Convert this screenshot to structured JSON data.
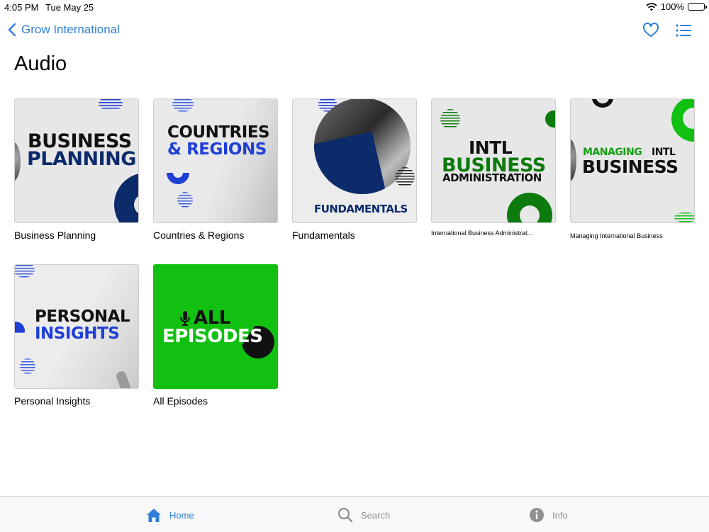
{
  "status_bar": {
    "time": "4:05 PM",
    "date": "Tue May 25",
    "battery": "100%"
  },
  "nav": {
    "back_label": "Grow International"
  },
  "page": {
    "title": "Audio"
  },
  "items": [
    {
      "label": "Business Planning",
      "art": [
        "BUSINESS",
        "PLANNING"
      ]
    },
    {
      "label": "Countries & Regions",
      "art": [
        "COUNTRIES",
        "& REGIONS"
      ]
    },
    {
      "label": "Fundamentals",
      "art": [
        "FUNDAMENTALS"
      ]
    },
    {
      "label": "International Business Administrat...",
      "art": [
        "INTL",
        "BUSINESS",
        "ADMINISTRATION"
      ]
    },
    {
      "label": "Managing International Business",
      "art": [
        "MANAGING",
        "INTL",
        "BUSINESS"
      ]
    },
    {
      "label": "Personal Insights",
      "art": [
        "PERSONAL",
        "INSIGHTS"
      ]
    },
    {
      "label": "All Episodes",
      "art": [
        "ALL",
        "EPISODES"
      ]
    }
  ],
  "tabs": [
    {
      "label": "Home",
      "icon": "house-icon"
    },
    {
      "label": "Search",
      "icon": "magnifier-icon"
    },
    {
      "label": "Info",
      "icon": "info-icon"
    }
  ],
  "colors": {
    "accent": "#2f7fd7",
    "navy": "#0b2b6b",
    "blue": "#1f3fd6",
    "green": "#0c7a0c",
    "bright_green": "#11c011"
  }
}
